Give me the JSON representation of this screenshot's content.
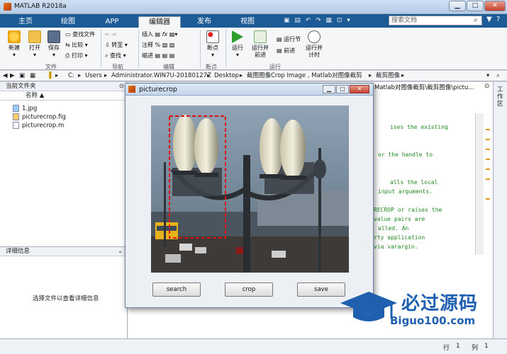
{
  "window": {
    "title": "MATLAB R2018a"
  },
  "tabs": [
    "主页",
    "绘图",
    "APP",
    "编辑器",
    "发布",
    "视图"
  ],
  "active_tab": "编辑器",
  "search": {
    "placeholder": "搜索文档"
  },
  "ribbon": {
    "file": {
      "new": "新建",
      "open": "打开",
      "save": "保存",
      "find_files": "查找文件",
      "compare": "比较",
      "print": "打印",
      "group": "文件"
    },
    "nav": {
      "goto": "转至",
      "find": "查找",
      "group": "导航"
    },
    "edit": {
      "insert": "插入",
      "comment": "注释",
      "indent": "缩进",
      "group": "编辑"
    },
    "breakpoint": {
      "label": "断点",
      "group": "断点"
    },
    "run": {
      "run": "运行",
      "run_advance": "运行并\n前进",
      "run_section": "运行节",
      "advance": "前进",
      "run_time": "运行并\n计时",
      "group": "运行"
    }
  },
  "address": {
    "parts": [
      "C:",
      "Users",
      "Administrator.WIN7U-20180127Z",
      "Desktop",
      "截图图像Crop Image , Matlab对图像截剪",
      "截剪图像"
    ]
  },
  "current_folder": {
    "header": "当前文件夹",
    "col_name": "名称 ▲",
    "files": [
      "1.jpg",
      "picturecrop.fig",
      "picturecrop.m"
    ]
  },
  "details": {
    "header": "详细信息",
    "hint": "选择文件以查看详细信息"
  },
  "editor": {
    "path": "Matlab对图像截剪\\截剪图像\\pictu...",
    "code_lines": [
      "ises the existing",
      "or the handle to",
      "alls the local",
      "input arguments.",
      "RECROP or raises the",
      "value pairs are",
      "alled.  An",
      "rty application",
      "via varargin."
    ]
  },
  "right_strip": {
    "label": "工作区"
  },
  "status": {
    "row_label": "行",
    "row": "1",
    "col_label": "列",
    "col": "1"
  },
  "figure": {
    "title": "picturecrop",
    "buttons": {
      "search": "search",
      "crop": "crop",
      "save": "save"
    }
  },
  "watermark": {
    "text": "必过源码",
    "url": "Biguo100.com"
  }
}
